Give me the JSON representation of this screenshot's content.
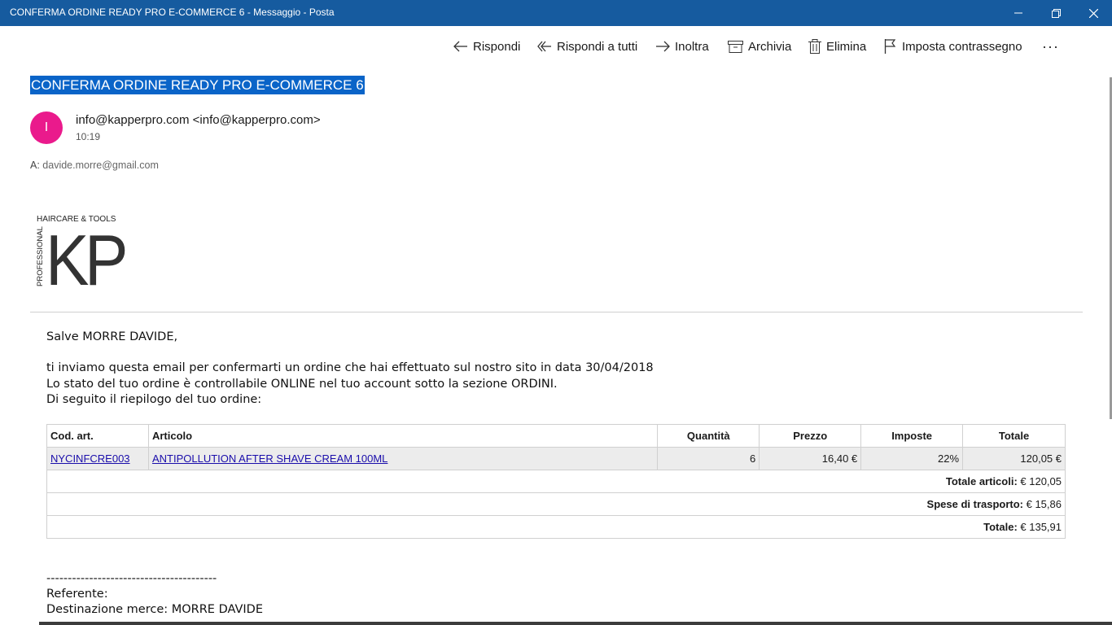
{
  "window": {
    "title": "CONFERMA ORDINE READY PRO E-COMMERCE 6 - Messaggio - Posta"
  },
  "toolbar": {
    "reply": "Rispondi",
    "reply_all": "Rispondi a tutti",
    "forward": "Inoltra",
    "archive": "Archivia",
    "delete": "Elimina",
    "flag": "Imposta contrassegno",
    "more": "···"
  },
  "message": {
    "subject": "CONFERMA ORDINE READY PRO E-COMMERCE 6",
    "avatar_letter": "I",
    "avatar_color": "#ea1a8c",
    "sender": "info@kapperpro.com <info@kapperpro.com>",
    "time": "10:19",
    "to_label": "A:",
    "to_address": "davide.morre@gmail.com"
  },
  "logo": {
    "tagline": "HAIRCARE & TOOLS",
    "side": "PROFESSIONAL",
    "mark": "KP"
  },
  "body": {
    "greeting": "Salve MORRE DAVIDE,",
    "line1": "ti inviamo questa email per confermarti un ordine che hai effettuato sul nostro sito in data 30/04/2018",
    "line2": "Lo stato del tuo ordine è controllabile ONLINE nel tuo account sotto la sezione ORDINI.",
    "line3": "Di seguito il riepilogo del tuo ordine:",
    "separator": "----------------------------------------",
    "referente": "Referente:",
    "destinazione": "Destinazione merce: MORRE DAVIDE"
  },
  "order": {
    "headers": [
      "Cod. art.",
      "Articolo",
      "Quantità",
      "Prezzo",
      "Imposte",
      "Totale"
    ],
    "item": {
      "code": "NYCINFCRE003",
      "name": "ANTIPOLLUTION AFTER SHAVE CREAM 100ML",
      "qty": "6",
      "price": "16,40 €",
      "tax": "22%",
      "total": "120,05 €"
    },
    "totale_articoli_label": "Totale articoli:",
    "totale_articoli_value": " € 120,05",
    "spese_label": "Spese di trasporto:",
    "spese_value": " € 15,86",
    "totale_label": "Totale:",
    "totale_value": " € 135,91"
  }
}
